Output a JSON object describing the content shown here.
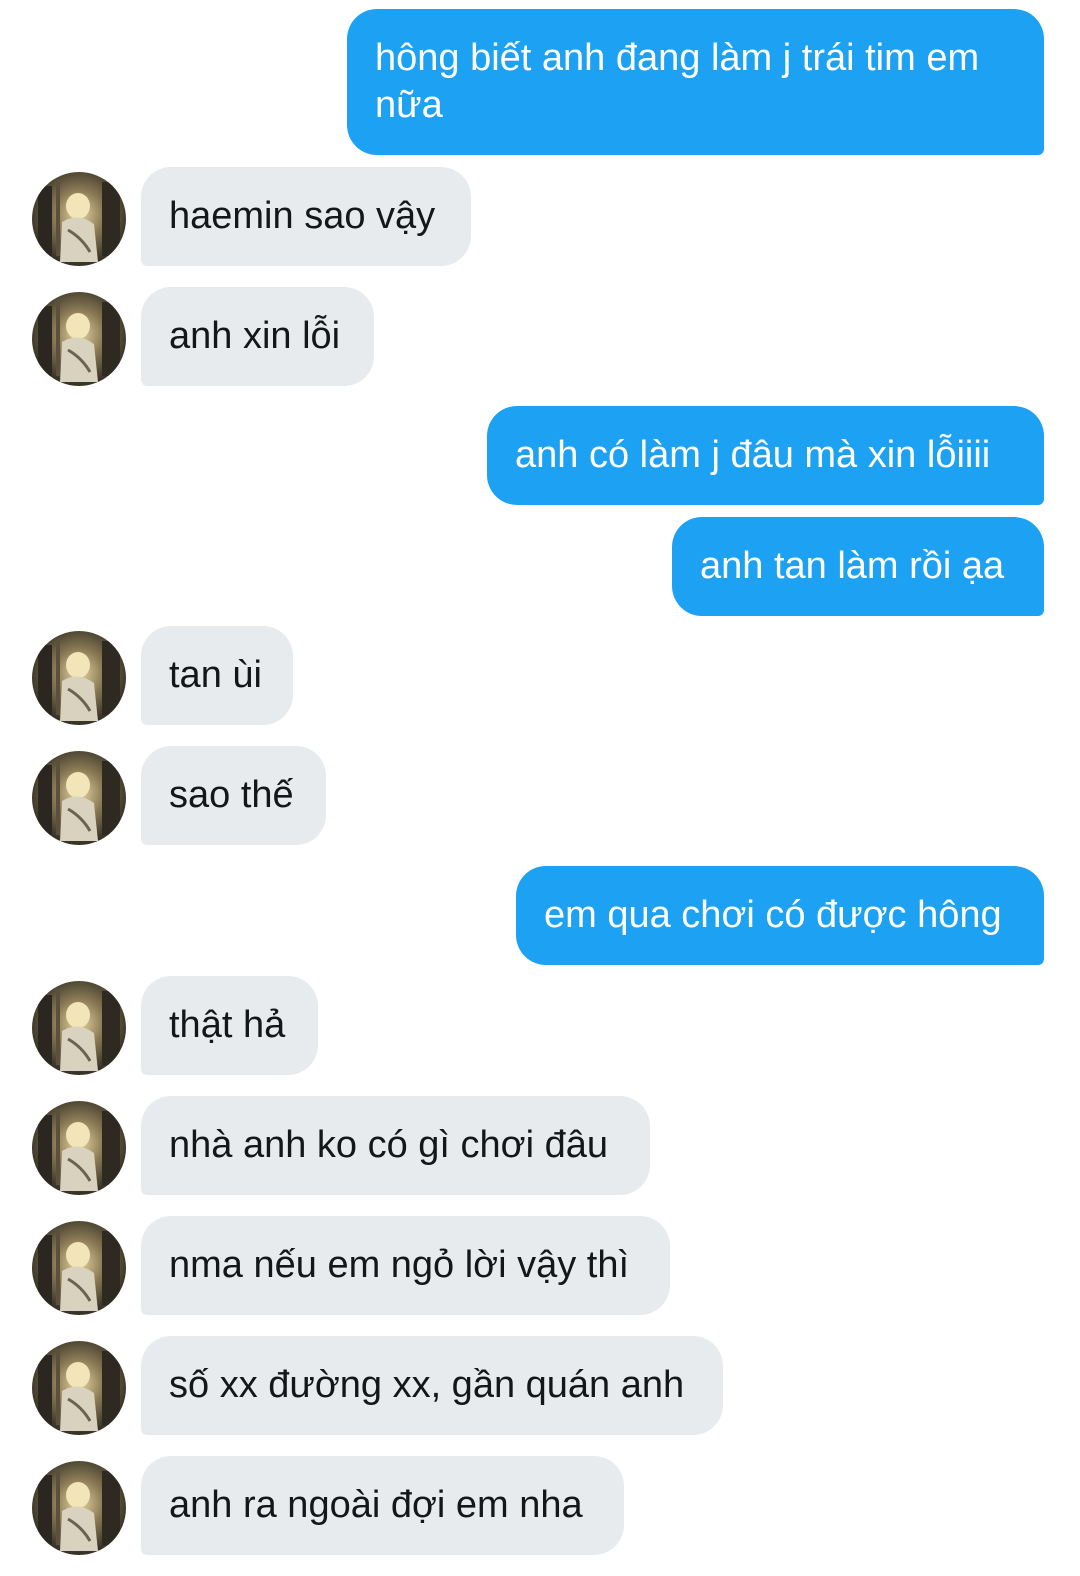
{
  "messages": [
    {
      "sender": "me",
      "text": "hông biết anh đang làm j trái tim em nữa"
    },
    {
      "sender": "them",
      "text": "haemin sao vậy",
      "avatar": "contact-avatar-icon"
    },
    {
      "sender": "them",
      "text": "anh xin lỗi",
      "avatar": "contact-avatar-icon"
    },
    {
      "sender": "me",
      "text": "anh có làm j đâu mà xin lỗiiii"
    },
    {
      "sender": "me",
      "text": "anh tan làm rồi ạa"
    },
    {
      "sender": "them",
      "text": "tan ùi",
      "avatar": "contact-avatar-icon"
    },
    {
      "sender": "them",
      "text": "sao thế",
      "avatar": "contact-avatar-icon"
    },
    {
      "sender": "me",
      "text": "em qua chơi có được hông"
    },
    {
      "sender": "them",
      "text": "thật hả",
      "avatar": "contact-avatar-icon"
    },
    {
      "sender": "them",
      "text": "nhà anh ko có gì chơi đâu",
      "avatar": "contact-avatar-icon"
    },
    {
      "sender": "them",
      "text": "nma nếu em ngỏ lời vậy thì",
      "avatar": "contact-avatar-icon"
    },
    {
      "sender": "them",
      "text": "số xx đường xx, gần quán anh",
      "avatar": "contact-avatar-icon"
    },
    {
      "sender": "them",
      "text": "anh ra ngoài đợi em nha",
      "avatar": "contact-avatar-icon"
    }
  ],
  "colors": {
    "sent_bubble": "#1da1f2",
    "sent_text": "#ffffff",
    "received_bubble": "#e8ebee",
    "received_text": "#14171a",
    "background": "#ffffff"
  }
}
